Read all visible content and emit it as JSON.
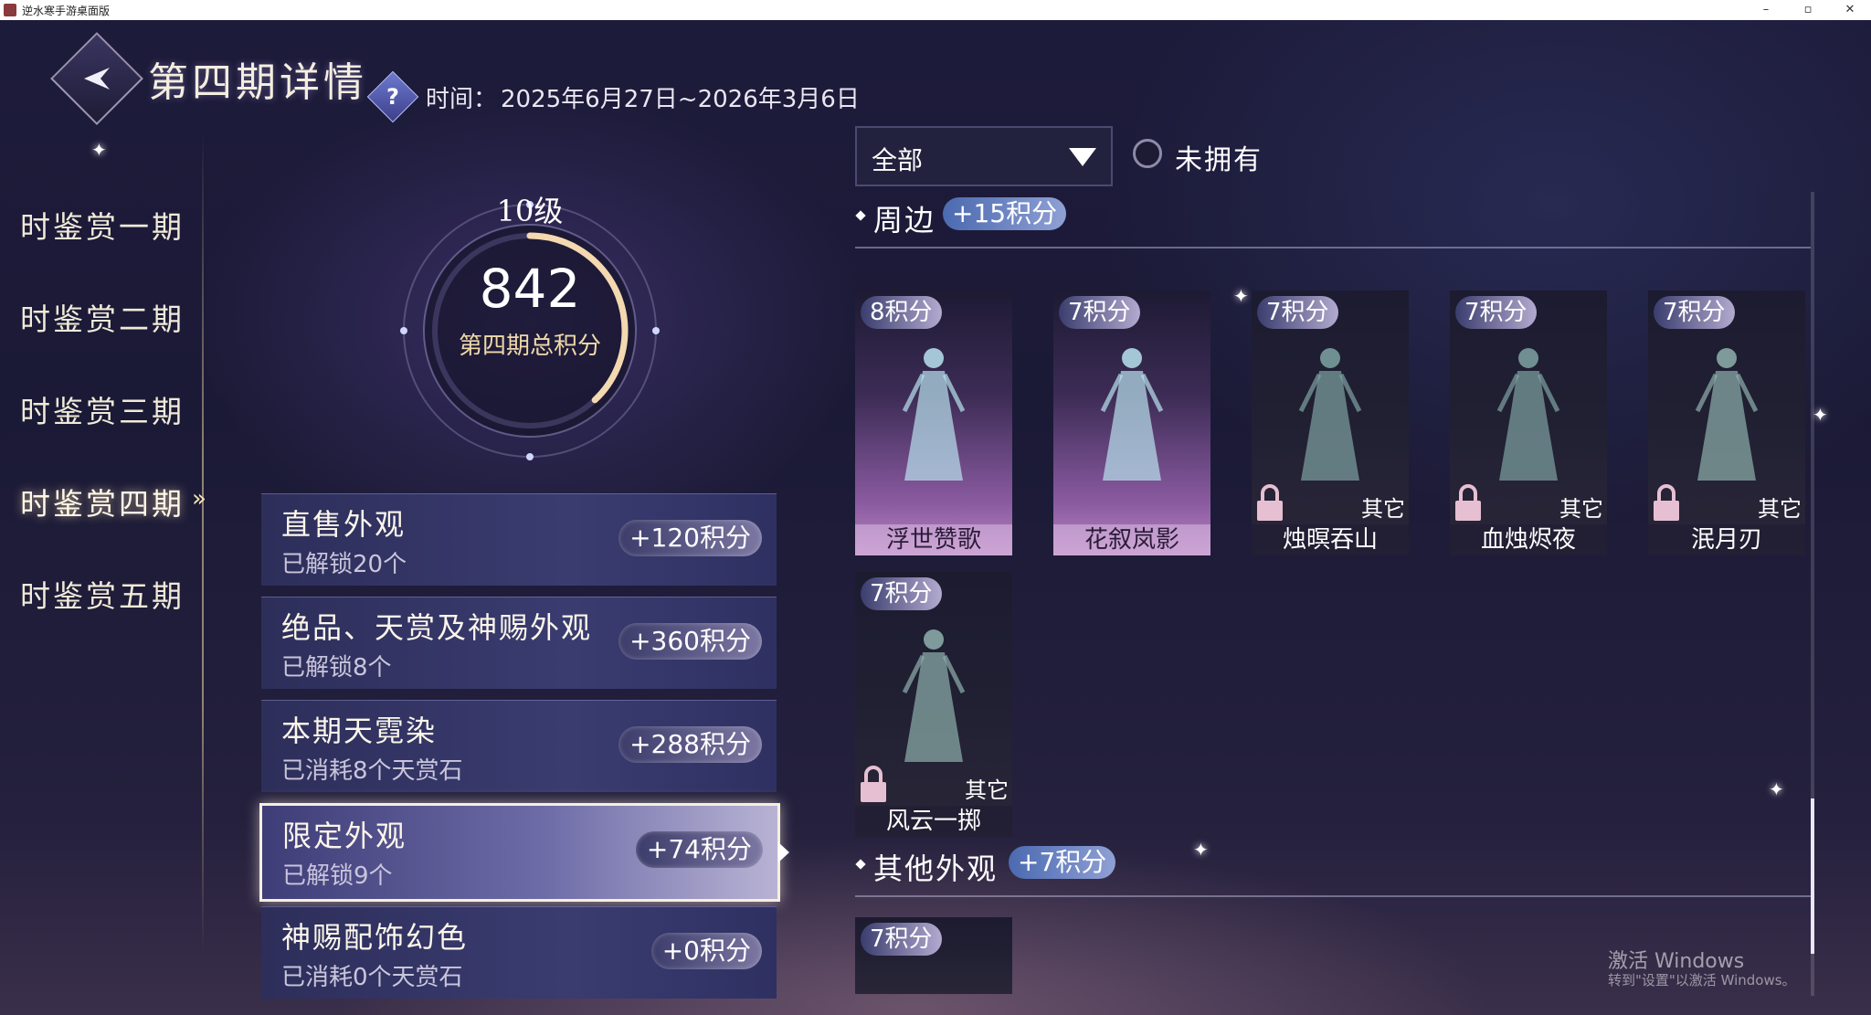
{
  "window": {
    "title": "逆水寒手游桌面版",
    "controls": {
      "minimize": "–",
      "maximize": "▫",
      "close": "✕"
    }
  },
  "header": {
    "title": "第四期详情",
    "help": "?",
    "time_label": "时间：",
    "time_value": "2025年6月27日~2026年3月6日"
  },
  "nav": {
    "items": [
      {
        "label": "时鉴赏一期"
      },
      {
        "label": "时鉴赏二期"
      },
      {
        "label": "时鉴赏三期"
      },
      {
        "label": "时鉴赏四期",
        "active": true
      },
      {
        "label": "时鉴赏五期"
      }
    ]
  },
  "summary": {
    "level": "10级",
    "total_score": "842",
    "score_label": "第四期总积分",
    "progress_fraction": 0.38
  },
  "categories": [
    {
      "title": "直售外观",
      "sub": "已解锁20个",
      "points": "+120积分"
    },
    {
      "title": "绝品、天赏及神赐外观",
      "sub": "已解锁8个",
      "points": "+360积分"
    },
    {
      "title": "本期天霓染",
      "sub": "已消耗8个天赏石",
      "points": "+288积分"
    },
    {
      "title": "限定外观",
      "sub": "已解锁9个",
      "points": "+74积分",
      "selected": true
    },
    {
      "title": "神赐配饰幻色",
      "sub": "已消耗0个天赏石",
      "points": "+0积分"
    }
  ],
  "filter": {
    "dropdown_value": "全部",
    "not_owned_label": "未拥有",
    "not_owned_checked": false
  },
  "sections": [
    {
      "title": "周边",
      "points": "+15积分",
      "cards": [
        {
          "points": "8积分",
          "name": "浮世赞歌",
          "owned": true
        },
        {
          "points": "7积分",
          "name": "花叙岚影",
          "owned": true
        },
        {
          "points": "7积分",
          "name": "烛暝吞山",
          "owned": false,
          "tag": "其它"
        },
        {
          "points": "7积分",
          "name": "血烛烬夜",
          "owned": false,
          "tag": "其它"
        },
        {
          "points": "7积分",
          "name": "泯月刃",
          "owned": false,
          "tag": "其它"
        },
        {
          "points": "7积分",
          "name": "风云一掷",
          "owned": false,
          "tag": "其它"
        }
      ]
    },
    {
      "title": "其他外观",
      "points": "+7积分",
      "cards": [
        {
          "points": "7积分"
        }
      ]
    }
  ],
  "watermark": {
    "line1": "激活 Windows",
    "line2": "转到\"设置\"以激活 Windows。"
  },
  "colors": {
    "background": "#1d1b3a",
    "accent_gold": "#f0d9a8",
    "owned_card": "#b987c0",
    "points_badge": "#8fa0d4"
  }
}
